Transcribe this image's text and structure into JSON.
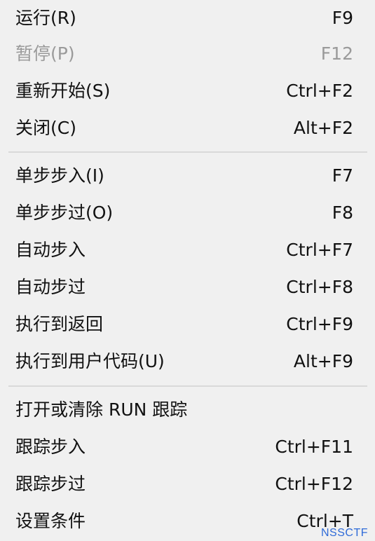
{
  "menu": {
    "items": [
      {
        "label": "运行(R)",
        "shortcut": "F9",
        "enabled": true
      },
      {
        "label": "暂停(P)",
        "shortcut": "F12",
        "enabled": false
      },
      {
        "label": "重新开始(S)",
        "shortcut": "Ctrl+F2",
        "enabled": true
      },
      {
        "label": "关闭(C)",
        "shortcut": "Alt+F2",
        "enabled": true
      },
      {
        "label": "单步步入(I)",
        "shortcut": "F7",
        "enabled": true
      },
      {
        "label": "单步步过(O)",
        "shortcut": "F8",
        "enabled": true
      },
      {
        "label": "自动步入",
        "shortcut": "Ctrl+F7",
        "enabled": true
      },
      {
        "label": "自动步过",
        "shortcut": "Ctrl+F8",
        "enabled": true
      },
      {
        "label": "执行到返回",
        "shortcut": "Ctrl+F9",
        "enabled": true
      },
      {
        "label": "执行到用户代码(U)",
        "shortcut": "Alt+F9",
        "enabled": true
      },
      {
        "label": "打开或清除 RUN 跟踪",
        "shortcut": "",
        "enabled": true
      },
      {
        "label": "跟踪步入",
        "shortcut": "Ctrl+F11",
        "enabled": true
      },
      {
        "label": "跟踪步过",
        "shortcut": "Ctrl+F12",
        "enabled": true
      },
      {
        "label": "设置条件",
        "shortcut": "Ctrl+T",
        "enabled": true
      }
    ]
  },
  "watermark": "NSSCTF"
}
